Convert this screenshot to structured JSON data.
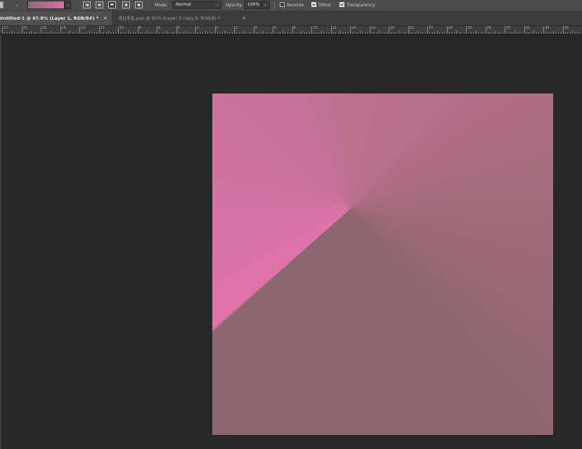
{
  "options_bar": {
    "mode_label": "Mode:",
    "mode_value": "Normal",
    "opacity_label": "Opacity:",
    "opacity_value": "100%",
    "reverse_label": "Reverse",
    "reverse_checked": false,
    "dither_label": "Dither",
    "dither_checked": true,
    "transparency_label": "Transparency",
    "transparency_checked": true,
    "gradient_preview_colors": [
      "#8d6a76",
      "#d96fa6"
    ],
    "gradient_style_selected": "angle"
  },
  "tabs": [
    {
      "label": "Untitled-1 @ 67.8% (Layer 1, RGB/8#) *",
      "close": "×",
      "active": true
    },
    {
      "label": "색상추출.psd @ 50% (Layer 3 copy 6, RGB/8) *",
      "close": "×",
      "active": false
    }
  ],
  "ruler": {
    "labels": [
      "22",
      "20",
      "18",
      "16",
      "14",
      "12",
      "10",
      "8",
      "6",
      "4",
      "2",
      "0",
      "2",
      "4",
      "6",
      "8",
      "10",
      "12",
      "14",
      "16",
      "18",
      "20",
      "22",
      "24",
      "26",
      "28",
      "30",
      "32",
      "34",
      "36"
    ]
  },
  "canvas": {
    "background": "#282828",
    "gradient_type": "angle",
    "colors": [
      "#df73ab",
      "#c56f98",
      "#a56b7d",
      "#8e676e"
    ]
  }
}
